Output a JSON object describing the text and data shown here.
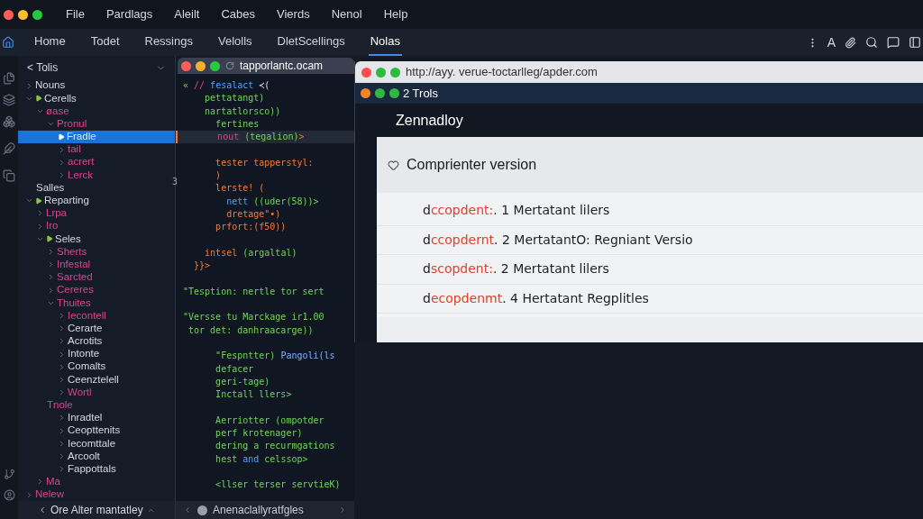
{
  "menu": [
    "File",
    "Pardlags",
    "Aleilt",
    "Cabes",
    "Vierds",
    "Nenol",
    "Help"
  ],
  "tabs": [
    {
      "label": "Home",
      "selected": false
    },
    {
      "label": "Todet",
      "selected": false
    },
    {
      "label": "Ressings",
      "selected": false
    },
    {
      "label": "Velolls",
      "selected": false
    },
    {
      "label": "DletScellings",
      "selected": false
    },
    {
      "label": "Nolas",
      "selected": true
    }
  ],
  "toolbar_text": "A",
  "sidebar": {
    "title": "< Tolis",
    "footer": "Ore Alter mantatley",
    "tree": [
      {
        "label": "Nouns",
        "kind": "folder",
        "expanded": false,
        "selected": false,
        "highlighted": false
      },
      {
        "label": "Cerells",
        "kind": "group",
        "expanded": true,
        "selected": false,
        "highlighted": false,
        "children": [
          {
            "label": "øase",
            "kind": "folder",
            "expanded": true,
            "selected": false,
            "highlighted": true,
            "children": [
              {
                "label": "Pronul",
                "kind": "folder",
                "expanded": true,
                "selected": false,
                "highlighted": true,
                "children": [
                  {
                    "label": "Fradle",
                    "kind": "group",
                    "expanded": false,
                    "selected": true
                  },
                  {
                    "label": "tail",
                    "kind": "folder",
                    "expanded": false,
                    "selected": false,
                    "highlighted": true
                  },
                  {
                    "label": "acrert",
                    "kind": "folder",
                    "expanded": false,
                    "selected": false,
                    "highlighted": true
                  },
                  {
                    "label": "Lerck",
                    "kind": "folder",
                    "expanded": false,
                    "selected": false,
                    "highlighted": true
                  }
                ]
              }
            ]
          },
          {
            "label": "Salles",
            "kind": "leaf",
            "selected": false,
            "highlighted": false
          }
        ]
      },
      {
        "label": "Reparting",
        "kind": "group",
        "expanded": true,
        "selected": false,
        "highlighted": false,
        "children": [
          {
            "label": "Lrpa",
            "kind": "folder",
            "expanded": false,
            "selected": false,
            "highlighted": true
          },
          {
            "label": "Iro",
            "kind": "folder",
            "expanded": false,
            "selected": false,
            "highlighted": true
          },
          {
            "label": "Seles",
            "kind": "group",
            "expanded": true,
            "selected": false,
            "highlighted": false,
            "children": [
              {
                "label": "Sherts",
                "kind": "folder",
                "expanded": false,
                "selected": false,
                "highlighted": true
              },
              {
                "label": "Infestal",
                "kind": "folder",
                "expanded": false,
                "selected": false,
                "highlighted": true
              },
              {
                "label": "Sarcted",
                "kind": "folder",
                "expanded": false,
                "selected": false,
                "highlighted": true
              },
              {
                "label": "Cereres",
                "kind": "folder",
                "expanded": false,
                "selected": false,
                "highlighted": true
              },
              {
                "label": "Thuites",
                "kind": "folder",
                "expanded": true,
                "selected": false,
                "highlighted": true,
                "children": [
                  {
                    "label": "Iecontell",
                    "kind": "folder",
                    "expanded": false,
                    "selected": false,
                    "highlighted": true
                  },
                  {
                    "label": "Cerarte",
                    "kind": "folder",
                    "expanded": false,
                    "selected": false,
                    "highlighted": false
                  },
                  {
                    "label": "Acrotits",
                    "kind": "folder",
                    "expanded": false,
                    "selected": false,
                    "highlighted": false
                  },
                  {
                    "label": "Intonte",
                    "kind": "folder",
                    "expanded": false,
                    "selected": false,
                    "highlighted": false
                  },
                  {
                    "label": "Comalts",
                    "kind": "folder",
                    "expanded": false,
                    "selected": false,
                    "highlighted": false
                  },
                  {
                    "label": "Ceenztelell",
                    "kind": "folder",
                    "expanded": false,
                    "selected": false,
                    "highlighted": false
                  },
                  {
                    "label": "Wortl",
                    "kind": "folder",
                    "expanded": false,
                    "selected": false,
                    "highlighted": true
                  }
                ]
              },
              {
                "label": "Tnole",
                "kind": "leaf",
                "selected": false,
                "highlighted": true,
                "children": [
                  {
                    "label": "Inradtel",
                    "kind": "folder",
                    "expanded": false,
                    "selected": false,
                    "highlighted": false
                  },
                  {
                    "label": "Ceopttenits",
                    "kind": "folder",
                    "expanded": false,
                    "selected": false,
                    "highlighted": false
                  },
                  {
                    "label": "Iecomttale",
                    "kind": "folder",
                    "expanded": false,
                    "selected": false,
                    "highlighted": false
                  },
                  {
                    "label": "Arcoolt",
                    "kind": "folder",
                    "expanded": false,
                    "selected": false,
                    "highlighted": false
                  },
                  {
                    "label": "Fappottals",
                    "kind": "folder",
                    "expanded": false,
                    "selected": false,
                    "highlighted": false
                  }
                ]
              }
            ]
          },
          {
            "label": "Ma",
            "kind": "folder",
            "expanded": false,
            "selected": false,
            "highlighted": true
          }
        ]
      },
      {
        "label": "Nelew",
        "kind": "folder",
        "expanded": false,
        "selected": false,
        "highlighted": true
      }
    ]
  },
  "editor": {
    "tab": "tapporlantc.ocam",
    "footer": "Anenaclallyratfgles",
    "gutter_mark": "3",
    "lines": [
      {
        "kind": "code",
        "selected": false,
        "segments": [
          {
            "text": "« ",
            "kind": "text"
          },
          {
            "text": "// ",
            "kind": "keyword"
          },
          {
            "text": "fesalact ",
            "kind": "name"
          },
          {
            "text": "≺(",
            "kind": "punct"
          }
        ]
      },
      {
        "kind": "code",
        "selected": false,
        "segments": [
          {
            "text": "    pettatangt)",
            "kind": "text"
          }
        ]
      },
      {
        "kind": "code",
        "selected": false,
        "segments": [
          {
            "text": "    nartatlorsco))",
            "kind": "text"
          }
        ]
      },
      {
        "kind": "code",
        "selected": false,
        "segments": [
          {
            "text": "      fertines",
            "kind": "text"
          }
        ]
      },
      {
        "kind": "code",
        "selected": true,
        "segments": [
          {
            "text": "      nout ",
            "kind": "keyword"
          },
          {
            "text": "(tegalion)",
            "kind": "text"
          },
          {
            "text": ">",
            "kind": "accent"
          }
        ]
      },
      {
        "kind": "blank"
      },
      {
        "kind": "code",
        "selected": false,
        "segments": [
          {
            "text": "      tester tapperstyl:",
            "kind": "accent"
          }
        ]
      },
      {
        "kind": "code",
        "selected": false,
        "segments": [
          {
            "text": "      )",
            "kind": "accent"
          }
        ]
      },
      {
        "kind": "code",
        "selected": false,
        "segments": [
          {
            "text": "      lerste! (",
            "kind": "accent"
          }
        ]
      },
      {
        "kind": "code",
        "selected": false,
        "segments": [
          {
            "text": "        nett ",
            "kind": "name"
          },
          {
            "text": "((uder(58))>",
            "kind": "text"
          }
        ]
      },
      {
        "kind": "code",
        "selected": false,
        "segments": [
          {
            "text": "        dretage\"•)",
            "kind": "accent"
          }
        ]
      },
      {
        "kind": "code",
        "selected": false,
        "segments": [
          {
            "text": "      prfort:(f50))",
            "kind": "accent"
          }
        ]
      },
      {
        "kind": "blank"
      },
      {
        "kind": "code",
        "selected": false,
        "segments": [
          {
            "text": "    intsel ",
            "kind": "accent"
          },
          {
            "text": "(argaltal)",
            "kind": "text"
          }
        ]
      },
      {
        "kind": "code",
        "selected": false,
        "segments": [
          {
            "text": "  }}>",
            "kind": "accent"
          }
        ]
      },
      {
        "kind": "blank"
      },
      {
        "kind": "code",
        "selected": false,
        "segments": [
          {
            "text": "\"Tesption: nertle tor sert",
            "kind": "text"
          }
        ]
      },
      {
        "kind": "blank"
      },
      {
        "kind": "code",
        "selected": false,
        "segments": [
          {
            "text": "\"Versse tu Marckage ir1.00",
            "kind": "text"
          }
        ]
      },
      {
        "kind": "code",
        "selected": false,
        "segments": [
          {
            "text": " tor det: danhraacarge))",
            "kind": "text"
          }
        ]
      },
      {
        "kind": "blank"
      },
      {
        "kind": "code",
        "selected": false,
        "segments": [
          {
            "text": "      \"Fespntter) ",
            "kind": "text"
          },
          {
            "text": "Pangoli(ls",
            "kind": "call"
          }
        ]
      },
      {
        "kind": "code",
        "selected": false,
        "segments": [
          {
            "text": "      defacer",
            "kind": "text"
          }
        ]
      },
      {
        "kind": "code",
        "selected": false,
        "segments": [
          {
            "text": "      geri-tage)",
            "kind": "text"
          }
        ]
      },
      {
        "kind": "code",
        "selected": false,
        "segments": [
          {
            "text": "      Inctall llers>",
            "kind": "text"
          }
        ]
      },
      {
        "kind": "blank"
      },
      {
        "kind": "code",
        "selected": false,
        "segments": [
          {
            "text": "      Aerriotter (ompotder",
            "kind": "text"
          }
        ]
      },
      {
        "kind": "code",
        "selected": false,
        "segments": [
          {
            "text": "      perf krotenager)",
            "kind": "text"
          }
        ]
      },
      {
        "kind": "code",
        "selected": false,
        "segments": [
          {
            "text": "      dering a recurmgations",
            "kind": "text"
          }
        ]
      },
      {
        "kind": "code",
        "selected": false,
        "segments": [
          {
            "text": "      hest ",
            "kind": "text"
          },
          {
            "text": "and",
            "kind": "name"
          },
          {
            "text": " celssop>",
            "kind": "text"
          }
        ]
      },
      {
        "kind": "blank"
      },
      {
        "kind": "code",
        "selected": false,
        "segments": [
          {
            "text": "      <llser terser servtieK)",
            "kind": "text"
          }
        ]
      }
    ]
  },
  "browser": {
    "url": "http://ayy. verue-toctarlleg/apder.com",
    "bar_title": "2 Trols",
    "heading": "Zennadloy",
    "section": {
      "title": "Comprienter version",
      "expanded": true,
      "rows": [
        {
          "lead": "d",
          "keyword": "ccopdent:",
          "rest": ". 1 Mertatant lilers"
        },
        {
          "lead": "d",
          "keyword": "ccopdernt",
          "rest": ". 2 MertatantO: Regniant Versio"
        },
        {
          "lead": "d",
          "keyword": "scopdent:",
          "rest": ". 2 Mertatant lilers"
        },
        {
          "lead": "d",
          "keyword": "ecopdenmt",
          "rest": ". 4 Hertatant Regplitles"
        }
      ]
    }
  }
}
